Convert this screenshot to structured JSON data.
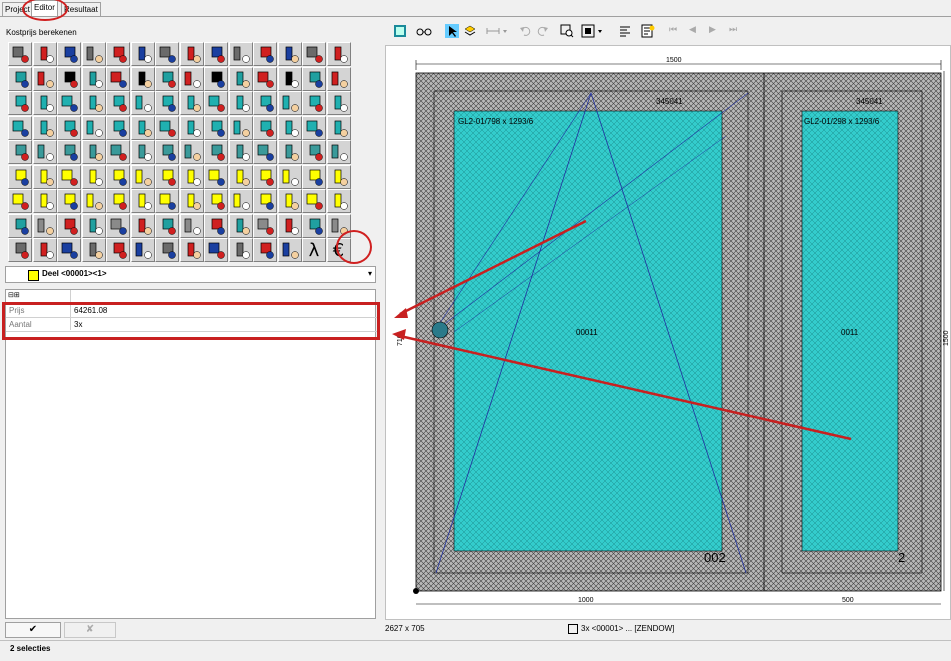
{
  "tabs": [
    "Project",
    "Editor",
    "Resultaat"
  ],
  "panel_title": "Kostprijs berekenen",
  "part_selector": {
    "label": "Deel <00001><1>"
  },
  "properties": [
    {
      "key": "Prijs",
      "value": "64261.08"
    },
    {
      "key": "Aantal",
      "value": "3x"
    }
  ],
  "buttons": {
    "ok": "✔",
    "cancel": "✘"
  },
  "status_bar": "2 selecties",
  "drawing": {
    "dim_top": "1500",
    "dim_bottom_left": "1000",
    "dim_bottom_right": "500",
    "dim_right": "1500",
    "glass_left": "GL2-01/798 x 1293/6",
    "glass_right": "GL2-01/298 x 1293/6",
    "profile_left": "345041",
    "profile_right": "345041",
    "center_left": "00011",
    "center_right": "0011",
    "sash_left": "002",
    "sash_right": "2",
    "dim_left": "710",
    "coordinates": "2627 x 705",
    "element_info": "3x <00001> ... [ZENDOW]"
  },
  "colors": {
    "accent": "#c82020",
    "glass": "#33cccc",
    "frame": "#808080"
  }
}
